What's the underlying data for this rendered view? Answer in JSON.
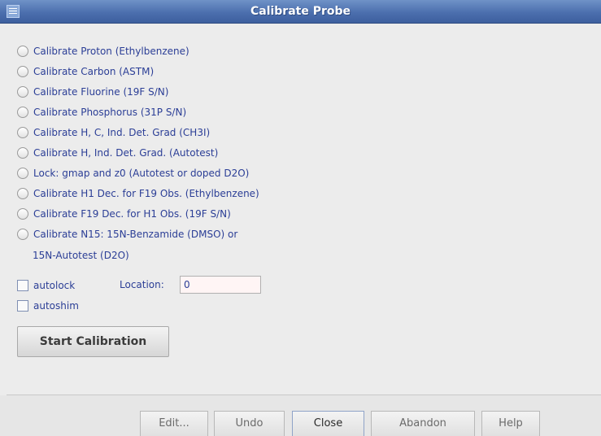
{
  "window": {
    "title": "Calibrate Probe",
    "icon": "window-menu-icon"
  },
  "options": [
    {
      "label": "Calibrate Proton (Ethylbenzene)"
    },
    {
      "label": "Calibrate Carbon (ASTM)"
    },
    {
      "label": "Calibrate Fluorine (19F S/N)"
    },
    {
      "label": "Calibrate Phosphorus (31P S/N)"
    },
    {
      "label": "Calibrate H, C, Ind. Det. Grad (CH3I)"
    },
    {
      "label": "Calibrate H, Ind. Det. Grad. (Autotest)"
    },
    {
      "label": "Lock: gmap and z0 (Autotest or doped D2O)"
    },
    {
      "label": "Calibrate H1 Dec. for F19 Obs. (Ethylbenzene)"
    },
    {
      "label": "Calibrate F19 Dec. for H1 Obs. (19F S/N)"
    },
    {
      "label": "Calibrate N15: 15N-Benzamide (DMSO) or",
      "continuation": "15N-Autotest (D2O)"
    }
  ],
  "autolock": {
    "label": "autolock",
    "checked": false
  },
  "autoshim": {
    "label": "autoshim",
    "checked": false
  },
  "location": {
    "label": "Location:",
    "value": "0"
  },
  "start_button": "Start Calibration",
  "buttons": {
    "edit": "Edit...",
    "undo": "Undo",
    "close": "Close",
    "abandon": "Abandon",
    "help": "Help"
  }
}
